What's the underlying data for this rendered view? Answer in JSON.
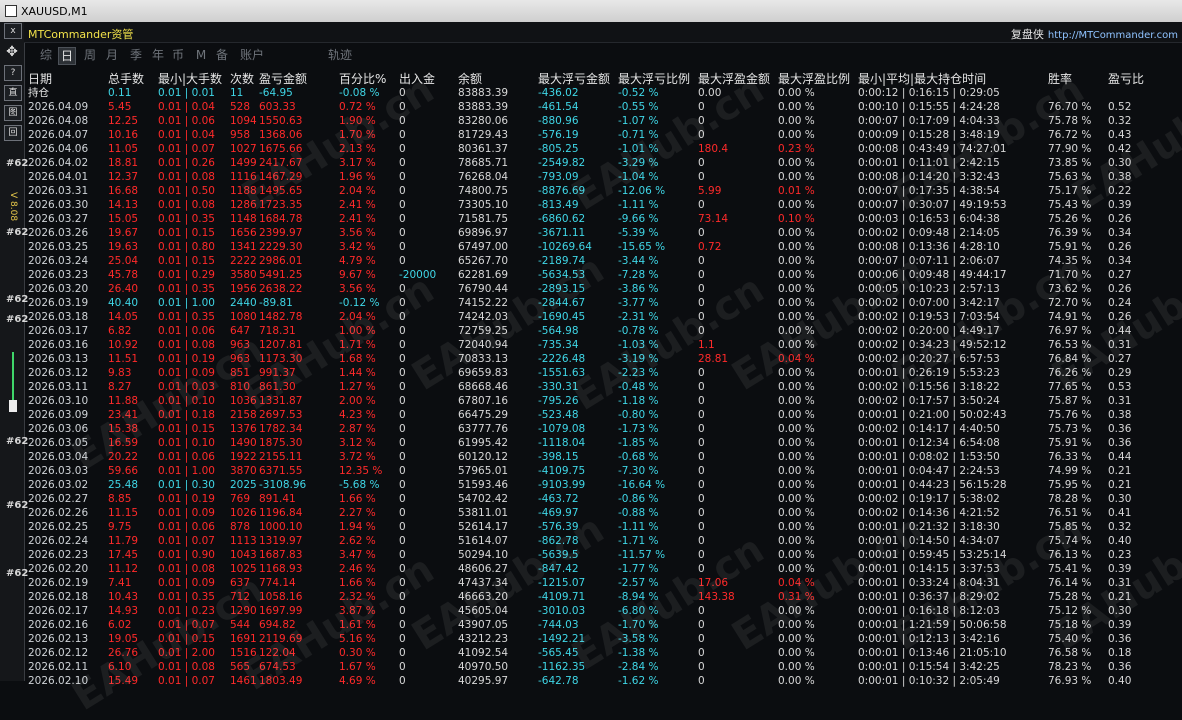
{
  "window": {
    "title": "XAUUSD,M1"
  },
  "app": {
    "title": "MTCommander资管",
    "brand": "复盘侠",
    "url": "http://MTCommander.com"
  },
  "sidebar": {
    "buttons": [
      "x",
      "?",
      "直",
      "图",
      "回"
    ],
    "version": "V 8.08",
    "labels": [
      "#62",
      "#62",
      "#62",
      "#62",
      "#62",
      "#62",
      "#62"
    ]
  },
  "tabs": [
    {
      "label": "综",
      "active": false
    },
    {
      "label": "日",
      "active": true
    },
    {
      "label": "周",
      "active": false
    },
    {
      "label": "月",
      "active": false
    },
    {
      "label": "季",
      "active": false
    },
    {
      "label": "年",
      "active": false
    },
    {
      "label": "币",
      "active": false
    },
    {
      "label": "M",
      "active": false
    },
    {
      "label": "备",
      "active": false
    },
    {
      "label": "账户",
      "active": false
    },
    {
      "label": "轨迹",
      "active": false
    }
  ],
  "colors": {
    "red": "#ff2a2a",
    "cyan": "#3fd6e6",
    "white": "#d8d8d8",
    "accent": "#f2e24a"
  },
  "watermark": "EAHub.cn",
  "table": {
    "headers": [
      "日期",
      "总手数",
      "最小|大手数",
      "次数",
      "盈亏金额",
      "百分比%",
      "出入金",
      "余额",
      "最大浮亏金额",
      "最大浮亏比例",
      "最大浮盈金额",
      "最大浮盈比例",
      "最小|平均|最大持仓时间",
      "胜率",
      "盈亏比"
    ],
    "rows": [
      [
        "持仓",
        "0.11",
        "0.01 | 0.01",
        "11",
        "-64.95",
        "-0.08 %",
        "0",
        "83883.39",
        "-436.02",
        "-0.52 %",
        "0.00",
        "0.00 %",
        "0:00:12 | 0:16:15 | 0:29:05",
        "",
        ""
      ],
      [
        "2026.04.09",
        "5.45",
        "0.01 | 0.04",
        "528",
        "603.33",
        "0.72 %",
        "0",
        "83883.39",
        "-461.54",
        "-0.55 %",
        "0",
        "0.00 %",
        "0:00:10 | 0:15:55 | 4:24:28",
        "76.70 %",
        "0.52"
      ],
      [
        "2026.04.08",
        "12.25",
        "0.01 | 0.06",
        "1094",
        "1550.63",
        "1.90 %",
        "0",
        "83280.06",
        "-880.96",
        "-1.07 %",
        "0",
        "0.00 %",
        "0:00:07 | 0:17:09 | 4:04:33",
        "75.78 %",
        "0.32"
      ],
      [
        "2026.04.07",
        "10.16",
        "0.01 | 0.04",
        "958",
        "1368.06",
        "1.70 %",
        "0",
        "81729.43",
        "-576.19",
        "-0.71 %",
        "0",
        "0.00 %",
        "0:00:09 | 0:15:28 | 3:48:19",
        "76.72 %",
        "0.43"
      ],
      [
        "2026.04.06",
        "11.05",
        "0.01 | 0.07",
        "1027",
        "1675.66",
        "2.13 %",
        "0",
        "80361.37",
        "-805.25",
        "-1.01 %",
        "180.4",
        "0.23 %",
        "0:00:08 | 0:43:49 | 74:27:01",
        "77.90 %",
        "0.42"
      ],
      [
        "2026.04.02",
        "18.81",
        "0.01 | 0.26",
        "1499",
        "2417.67",
        "3.17 %",
        "0",
        "78685.71",
        "-2549.82",
        "-3.29 %",
        "0",
        "0.00 %",
        "0:00:01 | 0:11:01 | 2:42:15",
        "73.85 %",
        "0.30"
      ],
      [
        "2026.04.01",
        "12.37",
        "0.01 | 0.08",
        "1116",
        "1467.29",
        "1.96 %",
        "0",
        "76268.04",
        "-793.09",
        "-1.04 %",
        "0",
        "0.00 %",
        "0:00:08 | 0:14:20 | 3:32:43",
        "75.63 %",
        "0.38"
      ],
      [
        "2026.03.31",
        "16.68",
        "0.01 | 0.50",
        "1188",
        "1495.65",
        "2.04 %",
        "0",
        "74800.75",
        "-8876.69",
        "-12.06 %",
        "5.99",
        "0.01 %",
        "0:00:07 | 0:17:35 | 4:38:54",
        "75.17 %",
        "0.22"
      ],
      [
        "2026.03.30",
        "14.13",
        "0.01 | 0.08",
        "1286",
        "1723.35",
        "2.41 %",
        "0",
        "73305.10",
        "-813.49",
        "-1.11 %",
        "0",
        "0.00 %",
        "0:00:07 | 0:30:07 | 49:19:53",
        "75.43 %",
        "0.39"
      ],
      [
        "2026.03.27",
        "15.05",
        "0.01 | 0.35",
        "1148",
        "1684.78",
        "2.41 %",
        "0",
        "71581.75",
        "-6860.62",
        "-9.66 %",
        "73.14",
        "0.10 %",
        "0:00:03 | 0:16:53 | 6:04:38",
        "75.26 %",
        "0.26"
      ],
      [
        "2026.03.26",
        "19.67",
        "0.01 | 0.15",
        "1656",
        "2399.97",
        "3.56 %",
        "0",
        "69896.97",
        "-3671.11",
        "-5.39 %",
        "0",
        "0.00 %",
        "0:00:02 | 0:09:48 | 2:14:05",
        "76.39 %",
        "0.34"
      ],
      [
        "2026.03.25",
        "19.63",
        "0.01 | 0.80",
        "1341",
        "2229.30",
        "3.42 %",
        "0",
        "67497.00",
        "-10269.64",
        "-15.65 %",
        "0.72",
        "0.00 %",
        "0:00:08 | 0:13:36 | 4:28:10",
        "75.91 %",
        "0.26"
      ],
      [
        "2026.03.24",
        "25.04",
        "0.01 | 0.15",
        "2222",
        "2986.01",
        "4.79 %",
        "0",
        "65267.70",
        "-2189.74",
        "-3.44 %",
        "0",
        "0.00 %",
        "0:00:07 | 0:07:11 | 2:06:07",
        "74.35 %",
        "0.34"
      ],
      [
        "2026.03.23",
        "45.78",
        "0.01 | 0.29",
        "3580",
        "5491.25",
        "9.67 %",
        "-20000",
        "62281.69",
        "-5634.53",
        "-7.28 %",
        "0",
        "0.00 %",
        "0:00:06 | 0:09:48 | 49:44:17",
        "71.70 %",
        "0.27"
      ],
      [
        "2026.03.20",
        "26.40",
        "0.01 | 0.35",
        "1956",
        "2638.22",
        "3.56 %",
        "0",
        "76790.44",
        "-2893.15",
        "-3.86 %",
        "0",
        "0.00 %",
        "0:00:05 | 0:10:23 | 2:57:13",
        "73.62 %",
        "0.26"
      ],
      [
        "2026.03.19",
        "40.40",
        "0.01 | 1.00",
        "2440",
        "-89.81",
        "-0.12 %",
        "0",
        "74152.22",
        "-2844.67",
        "-3.77 %",
        "0",
        "0.00 %",
        "0:00:02 | 0:07:00 | 3:42:17",
        "72.70 %",
        "0.24"
      ],
      [
        "2026.03.18",
        "14.05",
        "0.01 | 0.35",
        "1080",
        "1482.78",
        "2.04 %",
        "0",
        "74242.03",
        "-1690.45",
        "-2.31 %",
        "0",
        "0.00 %",
        "0:00:02 | 0:19:53 | 7:03:54",
        "74.91 %",
        "0.26"
      ],
      [
        "2026.03.17",
        "6.82",
        "0.01 | 0.06",
        "647",
        "718.31",
        "1.00 %",
        "0",
        "72759.25",
        "-564.98",
        "-0.78 %",
        "0",
        "0.00 %",
        "0:00:02 | 0:20:00 | 4:49:17",
        "76.97 %",
        "0.44"
      ],
      [
        "2026.03.16",
        "10.92",
        "0.01 | 0.08",
        "963",
        "1207.81",
        "1.71 %",
        "0",
        "72040.94",
        "-735.34",
        "-1.03 %",
        "1.1",
        "0.00 %",
        "0:00:02 | 0:34:23 | 49:52:12",
        "76.53 %",
        "0.31"
      ],
      [
        "2026.03.13",
        "11.51",
        "0.01 | 0.19",
        "963",
        "1173.30",
        "1.68 %",
        "0",
        "70833.13",
        "-2226.48",
        "-3.19 %",
        "28.81",
        "0.04 %",
        "0:00:02 | 0:20:27 | 6:57:53",
        "76.84 %",
        "0.27"
      ],
      [
        "2026.03.12",
        "9.83",
        "0.01 | 0.09",
        "851",
        "991.37",
        "1.44 %",
        "0",
        "69659.83",
        "-1551.63",
        "-2.23 %",
        "0",
        "0.00 %",
        "0:00:01 | 0:26:19 | 5:53:23",
        "76.26 %",
        "0.29"
      ],
      [
        "2026.03.11",
        "8.27",
        "0.01 | 0.03",
        "810",
        "861.30",
        "1.27 %",
        "0",
        "68668.46",
        "-330.31",
        "-0.48 %",
        "0",
        "0.00 %",
        "0:00:02 | 0:15:56 | 3:18:22",
        "77.65 %",
        "0.53"
      ],
      [
        "2026.03.10",
        "11.88",
        "0.01 | 0.10",
        "1036",
        "1331.87",
        "2.00 %",
        "0",
        "67807.16",
        "-795.26",
        "-1.18 %",
        "0",
        "0.00 %",
        "0:00:02 | 0:17:57 | 3:50:24",
        "75.87 %",
        "0.31"
      ],
      [
        "2026.03.09",
        "23.41",
        "0.01 | 0.18",
        "2158",
        "2697.53",
        "4.23 %",
        "0",
        "66475.29",
        "-523.48",
        "-0.80 %",
        "0",
        "0.00 %",
        "0:00:01 | 0:21:00 | 50:02:43",
        "75.76 %",
        "0.38"
      ],
      [
        "2026.03.06",
        "15.38",
        "0.01 | 0.15",
        "1376",
        "1782.34",
        "2.87 %",
        "0",
        "63777.76",
        "-1079.08",
        "-1.73 %",
        "0",
        "0.00 %",
        "0:00:02 | 0:14:17 | 4:40:50",
        "75.73 %",
        "0.36"
      ],
      [
        "2026.03.05",
        "16.59",
        "0.01 | 0.10",
        "1490",
        "1875.30",
        "3.12 %",
        "0",
        "61995.42",
        "-1118.04",
        "-1.85 %",
        "0",
        "0.00 %",
        "0:00:01 | 0:12:34 | 6:54:08",
        "75.91 %",
        "0.36"
      ],
      [
        "2026.03.04",
        "20.22",
        "0.01 | 0.06",
        "1922",
        "2155.11",
        "3.72 %",
        "0",
        "60120.12",
        "-398.15",
        "-0.68 %",
        "0",
        "0.00 %",
        "0:00:01 | 0:08:02 | 1:53:50",
        "76.33 %",
        "0.44"
      ],
      [
        "2026.03.03",
        "59.66",
        "0.01 | 1.00",
        "3870",
        "6371.55",
        "12.35 %",
        "0",
        "57965.01",
        "-4109.75",
        "-7.30 %",
        "0",
        "0.00 %",
        "0:00:01 | 0:04:47 | 2:24:53",
        "74.99 %",
        "0.21"
      ],
      [
        "2026.03.02",
        "25.48",
        "0.01 | 0.30",
        "2025",
        "-3108.96",
        "-5.68 %",
        "0",
        "51593.46",
        "-9103.99",
        "-16.64 %",
        "0",
        "0.00 %",
        "0:00:01 | 0:44:23 | 56:15:28",
        "75.95 %",
        "0.21"
      ],
      [
        "2026.02.27",
        "8.85",
        "0.01 | 0.19",
        "769",
        "891.41",
        "1.66 %",
        "0",
        "54702.42",
        "-463.72",
        "-0.86 %",
        "0",
        "0.00 %",
        "0:00:02 | 0:19:17 | 5:38:02",
        "78.28 %",
        "0.30"
      ],
      [
        "2026.02.26",
        "11.15",
        "0.01 | 0.09",
        "1026",
        "1196.84",
        "2.27 %",
        "0",
        "53811.01",
        "-469.97",
        "-0.88 %",
        "0",
        "0.00 %",
        "0:00:02 | 0:14:36 | 4:21:52",
        "76.51 %",
        "0.41"
      ],
      [
        "2026.02.25",
        "9.75",
        "0.01 | 0.06",
        "878",
        "1000.10",
        "1.94 %",
        "0",
        "52614.17",
        "-576.39",
        "-1.11 %",
        "0",
        "0.00 %",
        "0:00:01 | 0:21:32 | 3:18:30",
        "75.85 %",
        "0.32"
      ],
      [
        "2026.02.24",
        "11.79",
        "0.01 | 0.07",
        "1113",
        "1319.97",
        "2.62 %",
        "0",
        "51614.07",
        "-862.78",
        "-1.71 %",
        "0",
        "0.00 %",
        "0:00:01 | 0:14:50 | 4:34:07",
        "75.74 %",
        "0.40"
      ],
      [
        "2026.02.23",
        "17.45",
        "0.01 | 0.90",
        "1043",
        "1687.83",
        "3.47 %",
        "0",
        "50294.10",
        "-5639.5",
        "-11.57 %",
        "0",
        "0.00 %",
        "0:00:01 | 0:59:45 | 53:25:14",
        "76.13 %",
        "0.23"
      ],
      [
        "2026.02.20",
        "11.12",
        "0.01 | 0.08",
        "1025",
        "1168.93",
        "2.46 %",
        "0",
        "48606.27",
        "-847.42",
        "-1.77 %",
        "0",
        "0.00 %",
        "0:00:01 | 0:14:15 | 3:37:53",
        "75.41 %",
        "0.39"
      ],
      [
        "2026.02.19",
        "7.41",
        "0.01 | 0.09",
        "637",
        "774.14",
        "1.66 %",
        "0",
        "47437.34",
        "-1215.07",
        "-2.57 %",
        "17.06",
        "0.04 %",
        "0:00:01 | 0:33:24 | 8:04:31",
        "76.14 %",
        "0.31"
      ],
      [
        "2026.02.18",
        "10.43",
        "0.01 | 0.35",
        "712",
        "1058.16",
        "2.32 %",
        "0",
        "46663.20",
        "-4109.71",
        "-8.94 %",
        "143.38",
        "0.31 %",
        "0:00:01 | 0:36:37 | 8:29:02",
        "75.28 %",
        "0.21"
      ],
      [
        "2026.02.17",
        "14.93",
        "0.01 | 0.23",
        "1290",
        "1697.99",
        "3.87 %",
        "0",
        "45605.04",
        "-3010.03",
        "-6.80 %",
        "0",
        "0.00 %",
        "0:00:01 | 0:16:18 | 8:12:03",
        "75.12 %",
        "0.30"
      ],
      [
        "2026.02.16",
        "6.02",
        "0.01 | 0.07",
        "544",
        "694.82",
        "1.61 %",
        "0",
        "43907.05",
        "-744.03",
        "-1.70 %",
        "0",
        "0.00 %",
        "0:00:01 | 1:21:59 | 50:06:58",
        "75.18 %",
        "0.39"
      ],
      [
        "2026.02.13",
        "19.05",
        "0.01 | 0.15",
        "1691",
        "2119.69",
        "5.16 %",
        "0",
        "43212.23",
        "-1492.21",
        "-3.58 %",
        "0",
        "0.00 %",
        "0:00:01 | 0:12:13 | 3:42:16",
        "75.40 %",
        "0.36"
      ],
      [
        "2026.02.12",
        "26.76",
        "0.01 | 2.00",
        "1516",
        "122.04",
        "0.30 %",
        "0",
        "41092.54",
        "-565.45",
        "-1.38 %",
        "0",
        "0.00 %",
        "0:00:01 | 0:13:46 | 21:05:10",
        "76.58 %",
        "0.18"
      ],
      [
        "2026.02.11",
        "6.10",
        "0.01 | 0.08",
        "565",
        "674.53",
        "1.67 %",
        "0",
        "40970.50",
        "-1162.35",
        "-2.84 %",
        "0",
        "0.00 %",
        "0:00:01 | 0:15:54 | 3:42:25",
        "78.23 %",
        "0.36"
      ],
      [
        "2026.02.10",
        "15.49",
        "0.01 | 0.07",
        "1461",
        "1803.49",
        "4.69 %",
        "0",
        "40295.97",
        "-642.78",
        "-1.62 %",
        "0",
        "0.00 %",
        "0:00:01 | 0:10:32 | 2:05:49",
        "76.93 %",
        "0.40"
      ]
    ]
  }
}
